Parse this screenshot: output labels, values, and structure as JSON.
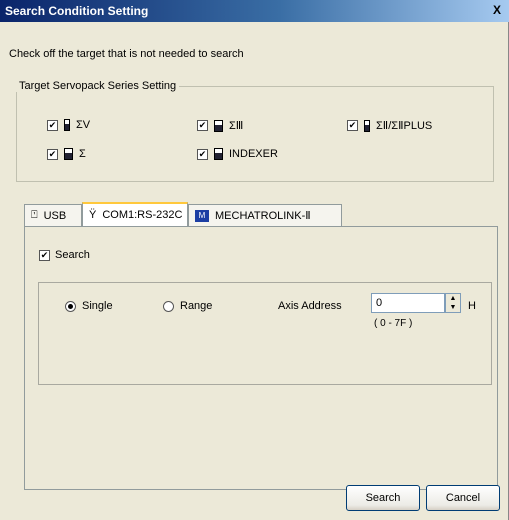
{
  "window": {
    "title": "Search Condition Setting",
    "close_glyph": "X"
  },
  "instruction": "Check off the target that is not needed to search",
  "series_group": {
    "legend": "Target Servopack Series Setting",
    "items": [
      {
        "label": "ΣV",
        "checked": true,
        "icon": "servopack-icon"
      },
      {
        "label": "ΣⅢ",
        "checked": true,
        "icon": "servopack-icon"
      },
      {
        "label": "ΣⅡ/ΣⅡPLUS",
        "checked": true,
        "icon": "servopack-icon"
      },
      {
        "label": "Σ",
        "checked": true,
        "icon": "servopack-icon"
      },
      {
        "label": "INDEXER",
        "checked": true,
        "icon": "indexer-icon"
      }
    ]
  },
  "tabs": [
    {
      "label": "USB",
      "icon": "usb-icon",
      "active": false
    },
    {
      "label": "COM1:RS-232C",
      "icon": "com-port-icon",
      "active": true
    },
    {
      "label": "MECHATROLINK-Ⅱ",
      "icon": "mechatrolink-icon",
      "active": false
    }
  ],
  "panel": {
    "search_label": "Search",
    "search_checked": true,
    "mode_single": "Single",
    "mode_range": "Range",
    "mode_selected": "Single",
    "axis_address_label": "Axis Address",
    "axis_address_value": "0",
    "unit_label": "H",
    "range_hint": "( 0 - 7F )"
  },
  "buttons": {
    "search": "Search",
    "cancel": "Cancel"
  },
  "colors": {
    "title_bar": "#0a246a",
    "dialog_bg": "#ece9d8",
    "active_tab_accent": "#ffc83c"
  }
}
